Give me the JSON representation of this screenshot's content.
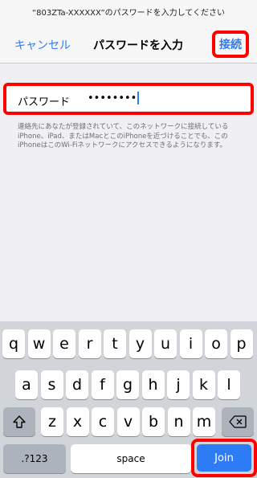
{
  "prompt": "“803ZTa-XXXXXX”のパスワードを入力してください",
  "navbar": {
    "cancel": "キャンセル",
    "title": "パスワードを入力",
    "connect": "接続"
  },
  "password": {
    "label": "パスワード",
    "masked_value": "••••••••"
  },
  "description": "連絡先にあなたが登録されていて、このネットワークに接続しているiPhone、iPad、またはMacとこのiPhoneを近づけることでも、このiPhoneはこのWi-Fiネットワークにアクセスできるようになります。",
  "keyboard": {
    "row1": [
      "q",
      "w",
      "e",
      "r",
      "t",
      "y",
      "u",
      "i",
      "o",
      "p"
    ],
    "row2": [
      "a",
      "s",
      "d",
      "f",
      "g",
      "h",
      "j",
      "k",
      "l"
    ],
    "row3": [
      "z",
      "x",
      "c",
      "v",
      "b",
      "n",
      "m"
    ],
    "numbers_label": ".?123",
    "space_label": "space",
    "join_label": "Join",
    "shift_icon": "shift-icon",
    "delete_icon": "backspace-icon"
  },
  "colors": {
    "accent": "#2d7cf6",
    "highlight": "#ff0000"
  }
}
